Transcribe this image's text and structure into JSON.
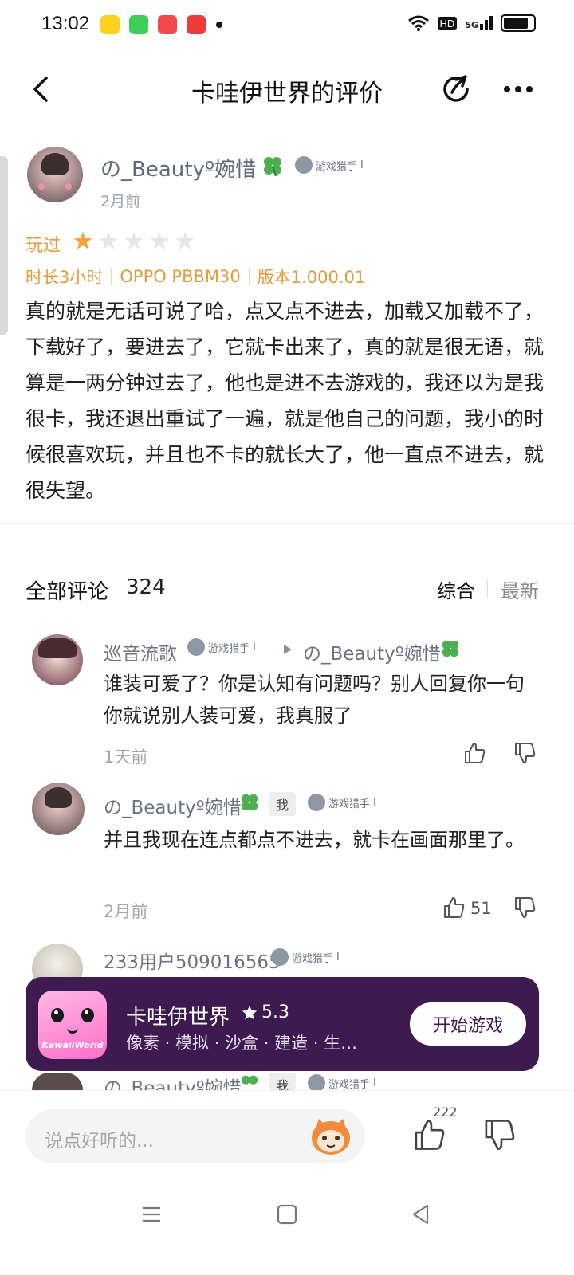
{
  "status_bar": {
    "time": "13:02",
    "app_icons": [
      "meituan-icon",
      "messages-icon",
      "video-icon",
      "music-icon"
    ],
    "network": "5G",
    "hd": "HD"
  },
  "header": {
    "title": "卡哇伊世界的评价"
  },
  "review": {
    "author": "の_Beautyº婉惜",
    "badge": "游戏猎手",
    "level": "Ⅰ",
    "time": "2月前",
    "played_label": "玩过",
    "rating": 1,
    "rating_max": 5,
    "meta": [
      "时长3小时",
      "OPPO PBBM30",
      "版本1.000.01"
    ],
    "text": "真的就是无话可说了哈，点又点不进去，加载又加载不了，下载好了，要进去了，它就卡出来了，真的就是很无语，就算是一两分钟过去了，他也是进不去游戏的，我还以为是我很卡，我还退出重试了一遍，就是他自己的问题，我小的时候很喜欢玩，并且也不卡的就长大了，他一直点不进去，就很失望。"
  },
  "comments_section": {
    "title": "全部评论",
    "count": "324",
    "sort_options": [
      "综合",
      "最新"
    ],
    "comments": [
      {
        "author": "巡音流歌",
        "badge": "游戏猎手",
        "reply_to": "の_Beautyº婉惜",
        "text": "谁装可爱了？你是认知有问题吗？别人回复你一句你就说别人装可爱，我真服了",
        "time": "1天前",
        "likes": ""
      },
      {
        "author": "の_Beautyº婉惜",
        "me_tag": "我",
        "badge": "游戏猎手",
        "text": "并且我现在连点都点不进去，就卡在画面那里了。",
        "time": "2月前",
        "likes": "51"
      },
      {
        "author": "233用户509016565",
        "badge": "游戏猎手"
      },
      {
        "author": "の_Beautyº婉惜",
        "me_tag": "我",
        "badge": "游戏猎手"
      }
    ]
  },
  "game_bar": {
    "name": "卡哇伊世界",
    "score": "5.3",
    "tags": "像素 · 模拟 · 沙盒 · 建造 · 生…",
    "icon_text": "KawaiiWorld",
    "button": "开始游戏"
  },
  "bottom_bar": {
    "placeholder": "说点好听的...",
    "like_count": "222"
  },
  "colors": {
    "accent_orange": "#e39a3c",
    "game_bar_bg": "#3d1a4f",
    "star_filled": "#f3a33a",
    "star_empty": "#e6e6e6"
  }
}
